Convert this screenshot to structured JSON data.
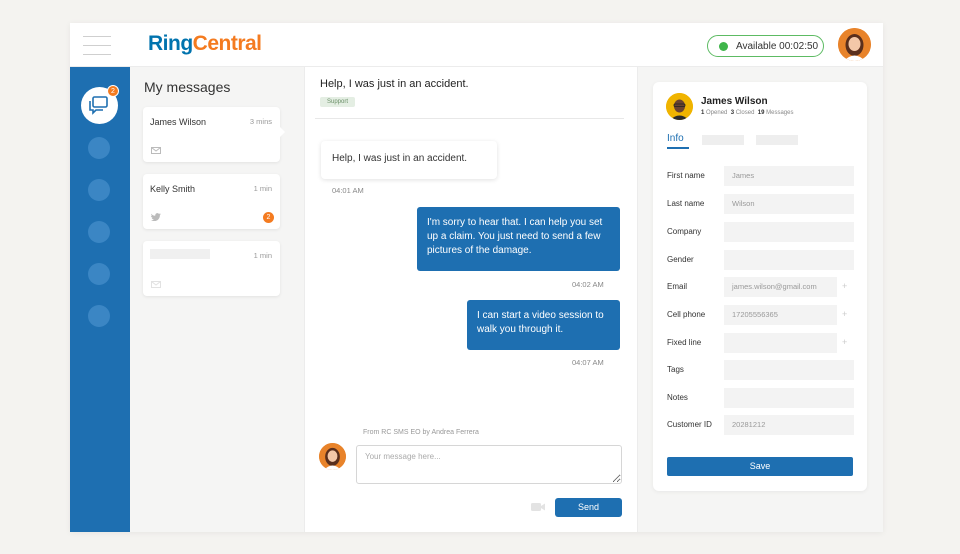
{
  "topbar": {
    "logo_part1": "Ring",
    "logo_part2": "Central",
    "status_label": "Available 00:02:50"
  },
  "leftnav": {
    "badge_count": "2"
  },
  "message_list": {
    "title": "My messages",
    "items": [
      {
        "name": "James Wilson",
        "time": "3 mins",
        "channel": "envelope-icon",
        "badge": ""
      },
      {
        "name": "Kelly Smith",
        "time": "1 min",
        "channel": "twitter-icon",
        "badge": "2"
      },
      {
        "name": "",
        "time": "1 min",
        "channel": "envelope-icon",
        "badge": ""
      }
    ]
  },
  "chat": {
    "title": "Help, I was just in an accident.",
    "tag": "Support",
    "messages": [
      {
        "direction": "in",
        "text": "Help, I was just in an accident.",
        "time": "04:01 AM"
      },
      {
        "direction": "out",
        "text": "I'm sorry to hear that. I can help you set up a claim. You just need to send a few pictures of the damage.",
        "time": "04:02 AM"
      },
      {
        "direction": "out",
        "text": "I can start a video session to walk you through it.",
        "time": "04:07 AM"
      }
    ],
    "from_label": "From RC SMS EO by Andrea Ferrera",
    "input_placeholder": "Your message here...",
    "send_label": "Send"
  },
  "contact": {
    "name": "James Wilson",
    "opened_count": "1",
    "opened_label": "Opened",
    "closed_count": "3",
    "closed_label": "Closed",
    "messages_count": "19",
    "messages_label": "Messages",
    "tab_info": "Info",
    "fields": [
      {
        "label": "First name",
        "value": "James",
        "plus": false
      },
      {
        "label": "Last name",
        "value": "Wilson",
        "plus": false
      },
      {
        "label": "Company",
        "value": "",
        "plus": false
      },
      {
        "label": "Gender",
        "value": "",
        "plus": false
      },
      {
        "label": "Email",
        "value": "james.wilson@gmail.com",
        "plus": true
      },
      {
        "label": "Cell phone",
        "value": "17205556365",
        "plus": true
      },
      {
        "label": "Fixed line",
        "value": "",
        "plus": true
      },
      {
        "label": "Tags",
        "value": "",
        "plus": false
      },
      {
        "label": "Notes",
        "value": "",
        "plus": false
      },
      {
        "label": "Customer ID",
        "value": "20281212",
        "plus": false
      }
    ],
    "save_label": "Save"
  },
  "colors": {
    "primary_blue": "#1e6fb1",
    "accent_orange": "#f47b20",
    "available_green": "#3fb54a"
  }
}
